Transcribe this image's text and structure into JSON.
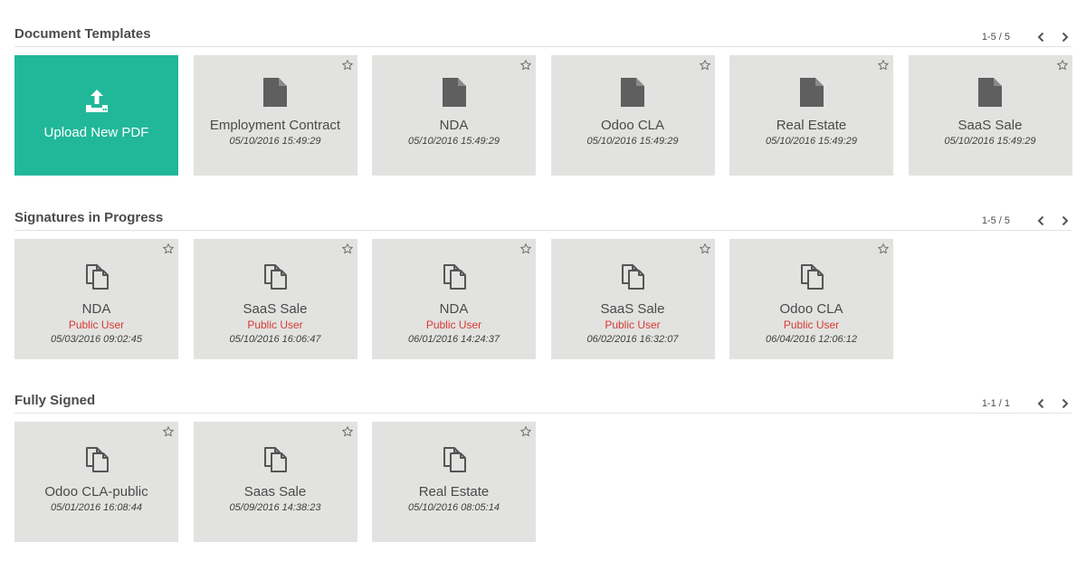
{
  "colors": {
    "upload_bg": "#21b799",
    "card_bg": "#e2e2e0",
    "public_user": "#d63b35"
  },
  "templates": {
    "title": "Document Templates",
    "pager": "1-5 / 5",
    "upload_label": "Upload New PDF",
    "upload_icon": "upload-icon",
    "cards": [
      {
        "name": "Employment Contract",
        "date": "05/10/2016 15:49:29",
        "icon": "file-icon"
      },
      {
        "name": "NDA",
        "date": "05/10/2016 15:49:29",
        "icon": "file-icon"
      },
      {
        "name": "Odoo CLA",
        "date": "05/10/2016 15:49:29",
        "icon": "file-icon"
      },
      {
        "name": "Real Estate",
        "date": "05/10/2016 15:49:29",
        "icon": "file-icon"
      },
      {
        "name": "SaaS Sale",
        "date": "05/10/2016 15:49:29",
        "icon": "file-icon"
      }
    ]
  },
  "in_progress": {
    "title": "Signatures in Progress",
    "pager": "1-5 / 5",
    "cards": [
      {
        "name": "NDA",
        "user": "Public User",
        "date": "05/03/2016 09:02:45",
        "icon": "copy-icon"
      },
      {
        "name": "SaaS Sale",
        "user": "Public User",
        "date": "05/10/2016 16:06:47",
        "icon": "copy-icon"
      },
      {
        "name": "NDA",
        "user": "Public User",
        "date": "06/01/2016 14:24:37",
        "icon": "copy-icon"
      },
      {
        "name": "SaaS Sale",
        "user": "Public User",
        "date": "06/02/2016 16:32:07",
        "icon": "copy-icon"
      },
      {
        "name": "Odoo CLA",
        "user": "Public User",
        "date": "06/04/2016 12:06:12",
        "icon": "copy-icon"
      }
    ]
  },
  "signed": {
    "title": "Fully Signed",
    "pager": "1-1 / 1",
    "cards": [
      {
        "name": "Odoo CLA-public",
        "date": "05/01/2016 16:08:44",
        "icon": "copy-icon"
      },
      {
        "name": "Saas Sale",
        "date": "05/09/2016 14:38:23",
        "icon": "copy-icon"
      },
      {
        "name": "Real Estate",
        "date": "05/10/2016 08:05:14",
        "icon": "copy-icon"
      }
    ]
  },
  "icons": {
    "star": "star-outline-icon",
    "prev": "chevron-left-icon",
    "next": "chevron-right-icon"
  }
}
